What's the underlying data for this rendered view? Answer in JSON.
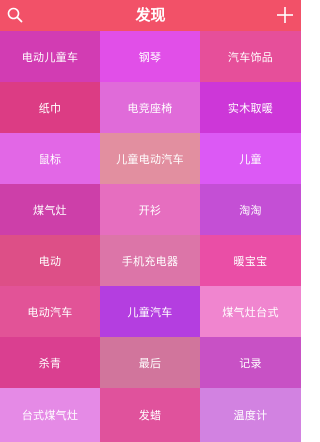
{
  "header": {
    "title": "发现",
    "background": "#f25168",
    "left_icon": "search-icon",
    "right_icon": "plus-icon"
  },
  "grid": {
    "cells": [
      {
        "label": "电动儿童车",
        "color": "#d23cb3"
      },
      {
        "label": "钢琴",
        "color": "#e14fe8"
      },
      {
        "label": "汽车饰品",
        "color": "#e64f9a"
      },
      {
        "label": "纸巾",
        "color": "#dc3c84"
      },
      {
        "label": "电竞座椅",
        "color": "#e06bd9"
      },
      {
        "label": "实木取暖",
        "color": "#cd37d8"
      },
      {
        "label": "鼠标",
        "color": "#e267e6"
      },
      {
        "label": "儿童电动汽车",
        "color": "#e28fa0"
      },
      {
        "label": "儿童",
        "color": "#dc59f5"
      },
      {
        "label": "煤气灶",
        "color": "#cd3fa9"
      },
      {
        "label": "开衫",
        "color": "#e66ebf"
      },
      {
        "label": "淘淘",
        "color": "#c44fd5"
      },
      {
        "label": "电动",
        "color": "#dd4f87"
      },
      {
        "label": "手机充电器",
        "color": "#dc75a8"
      },
      {
        "label": "暖宝宝",
        "color": "#ea4ea6"
      },
      {
        "label": "电动汽车",
        "color": "#e25397"
      },
      {
        "label": "儿童汽车",
        "color": "#b43ee0"
      },
      {
        "label": "煤气灶台式",
        "color": "#f085cf"
      },
      {
        "label": "杀青",
        "color": "#da3f90"
      },
      {
        "label": "最后",
        "color": "#d1759c"
      },
      {
        "label": "记录",
        "color": "#c851c5"
      },
      {
        "label": "台式煤气灶",
        "color": "#e58ae6"
      },
      {
        "label": "发蜡",
        "color": "#e0529c"
      },
      {
        "label": "温度计",
        "color": "#d282e1"
      }
    ]
  }
}
